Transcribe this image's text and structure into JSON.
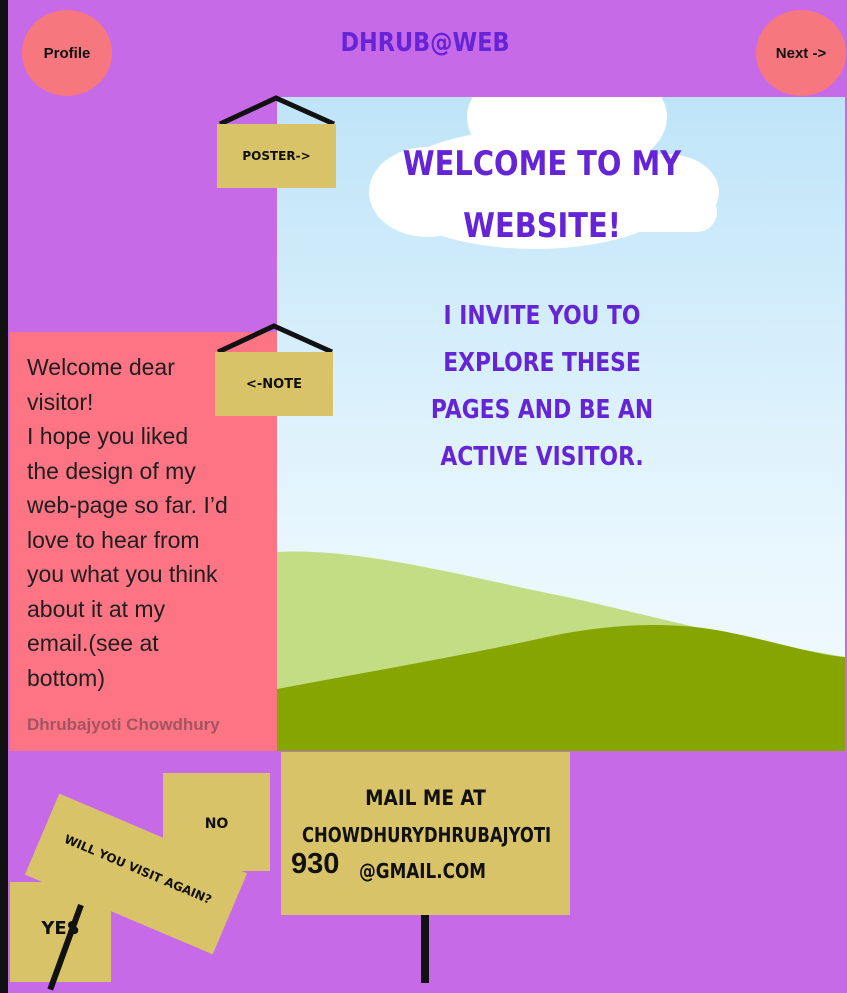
{
  "header": {
    "profile_label": "Profile",
    "brand": "DHRUB@WEB",
    "next_label": "Next ->"
  },
  "hero": {
    "title": "WELCOME TO MY WEBSITE!",
    "invite": "I INVITE YOU TO EXPLORE THESE PAGES AND BE AN ACTIVE VISITOR."
  },
  "poster_sign": {
    "label": "POSTER->"
  },
  "note_sign": {
    "label": "<-NOTE"
  },
  "note": {
    "text": "Welcome dear visitor! I hope you liked the design of my web-page so far. I’d love to hear from you what you think about it at my email.(see at bottom)",
    "line1": "Welcome dear",
    "line2": "visitor!",
    "line3": "I hope you liked",
    "line4": "the design of my",
    "line5": "web-page so far. I’d",
    "line6": "love to hear from",
    "line7": "you what you think",
    "line8": "about it at my",
    "line9": "email.(see at",
    "line10": "bottom)",
    "author": "Dhrubajyoti Chowdhury"
  },
  "poll": {
    "question": "WILL YOU VISIT AGAIN?",
    "yes_label": "YES",
    "no_label": "NO"
  },
  "mail": {
    "heading": "MAIL ME AT",
    "address_part1": "CHOWDHURYDHRUBAJYOTI",
    "address_part2": "930",
    "address_part3": "@GMAIL.COM"
  },
  "colors": {
    "background": "#c76ae8",
    "accent_purple_text": "#6524d6",
    "pink_button": "#f7777f",
    "note_pink": "#fd7584",
    "sign_yellow": "#d8c368",
    "sky": "#bfe4f8",
    "hill_light": "#c3dd84",
    "hill_dark": "#86a500"
  }
}
